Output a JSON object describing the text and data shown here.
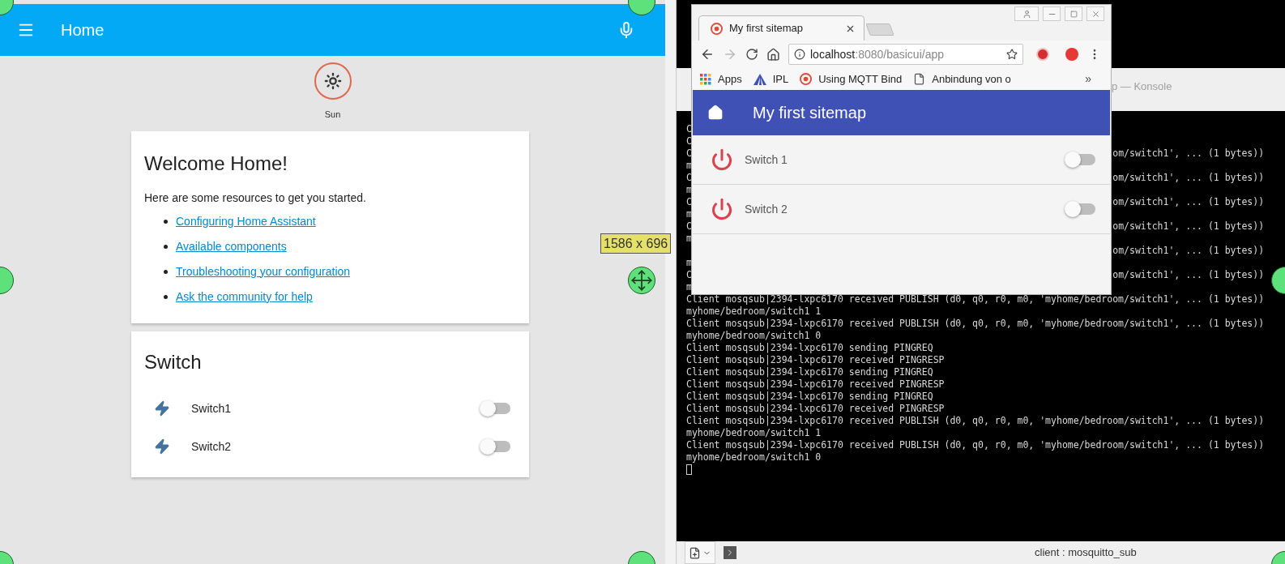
{
  "home_assistant": {
    "toolbar": {
      "title": "Home"
    },
    "badges": [
      {
        "label": "Sun"
      }
    ],
    "welcome_card": {
      "title": "Welcome Home!",
      "intro": "Here are some resources to get you started.",
      "links": [
        "Configuring Home Assistant",
        "Available components",
        "Troubleshooting your configuration",
        "Ask the community for help"
      ]
    },
    "switch_card": {
      "title": "Switch",
      "entities": [
        {
          "name": "Switch1",
          "on": false
        },
        {
          "name": "Switch2",
          "on": false
        }
      ]
    }
  },
  "capture_overlay": {
    "size_label": "1586 x 696"
  },
  "konsole": {
    "title": "p — Konsole",
    "lines": [
      {
        "kind": "partial",
        "head": "C"
      },
      {
        "kind": "partial",
        "head": "C"
      },
      {
        "kind": "partial",
        "head": "C",
        "tail": "om/switch1', ... (1 bytes))"
      },
      {
        "kind": "partial",
        "head": "m"
      },
      {
        "kind": "partial",
        "head": "C",
        "tail": "om/switch1', ... (1 bytes))"
      },
      {
        "kind": "partial",
        "head": "m"
      },
      {
        "kind": "partial",
        "head": "C",
        "tail": "om/switch1', ... (1 bytes))"
      },
      {
        "kind": "partial",
        "head": "m"
      },
      {
        "kind": "partial",
        "head": "C",
        "tail": "om/switch1', ... (1 bytes))"
      },
      {
        "kind": "partial",
        "head": "m"
      },
      {
        "kind": "partial",
        "tail": "om/switch1', ... (1 bytes))"
      },
      {
        "kind": "partial",
        "head": "m"
      },
      {
        "kind": "partial",
        "head": "C",
        "tail": "om/switch1', ... (1 bytes))"
      },
      {
        "kind": "partial",
        "head": "m"
      },
      {
        "kind": "full",
        "text": "Client mosqsub|2394-lxpc6170 received PUBLISH (d0, q0, r0, m0, 'myhome/bedroom/switch1', ... (1 bytes))"
      },
      {
        "kind": "full",
        "text": "myhome/bedroom/switch1 1"
      },
      {
        "kind": "full",
        "text": "Client mosqsub|2394-lxpc6170 received PUBLISH (d0, q0, r0, m0, 'myhome/bedroom/switch1', ... (1 bytes))"
      },
      {
        "kind": "full",
        "text": "myhome/bedroom/switch1 0"
      },
      {
        "kind": "full",
        "text": "Client mosqsub|2394-lxpc6170 sending PINGREQ"
      },
      {
        "kind": "full",
        "text": "Client mosqsub|2394-lxpc6170 received PINGRESP"
      },
      {
        "kind": "full",
        "text": "Client mosqsub|2394-lxpc6170 sending PINGREQ"
      },
      {
        "kind": "full",
        "text": "Client mosqsub|2394-lxpc6170 received PINGRESP"
      },
      {
        "kind": "full",
        "text": "Client mosqsub|2394-lxpc6170 sending PINGREQ"
      },
      {
        "kind": "full",
        "text": "Client mosqsub|2394-lxpc6170 received PINGRESP"
      },
      {
        "kind": "full",
        "text": "Client mosqsub|2394-lxpc6170 received PUBLISH (d0, q0, r0, m0, 'myhome/bedroom/switch1', ... (1 bytes))"
      },
      {
        "kind": "full",
        "text": "myhome/bedroom/switch1 1"
      },
      {
        "kind": "full",
        "text": "Client mosqsub|2394-lxpc6170 received PUBLISH (d0, q0, r0, m0, 'myhome/bedroom/switch1', ... (1 bytes))"
      },
      {
        "kind": "full",
        "text": "myhome/bedroom/switch1 0"
      },
      {
        "kind": "cursor"
      }
    ],
    "status": "client : mosquitto_sub"
  },
  "browser": {
    "tab": {
      "title": "My first sitemap"
    },
    "url_host": "localhost",
    "url_path": ":8080/basicui/app",
    "bookmarks": [
      {
        "kind": "apps",
        "label": "Apps"
      },
      {
        "kind": "triangle",
        "label": "IPL"
      },
      {
        "kind": "site",
        "label": "Using MQTT Bind"
      },
      {
        "kind": "page",
        "label": "Anbindung von o"
      }
    ],
    "bookmarks_more": "»",
    "app": {
      "title": "My first sitemap",
      "items": [
        {
          "label": "Switch 1",
          "on": false
        },
        {
          "label": "Switch 2",
          "on": false
        }
      ]
    }
  }
}
